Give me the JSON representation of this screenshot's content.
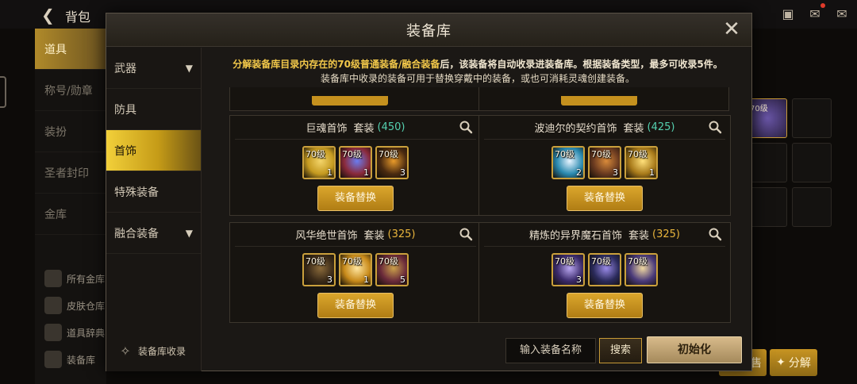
{
  "background": {
    "back_arrow": "back-arrow-icon",
    "title": "背包",
    "tabs": [
      "道具",
      "称号/勋章",
      "装扮",
      "圣者封印",
      "金库"
    ],
    "tools": [
      "所有金库",
      "皮肤仓库",
      "道具辞典",
      "装备库"
    ],
    "grid_item_level": "70级",
    "decompose": "分解",
    "sell": "售"
  },
  "modal": {
    "title": "装备库",
    "close_icon": "close-icon",
    "categories": [
      {
        "label": "武器",
        "expandable": true
      },
      {
        "label": "防具",
        "expandable": false
      },
      {
        "label": "首饰",
        "expandable": false,
        "active": true
      },
      {
        "label": "特殊装备",
        "expandable": false
      },
      {
        "label": "融合装备",
        "expandable": true
      }
    ],
    "collect_label": "装备库收录",
    "notice_line1_a": "分解装备库目录内存在的70级普通装备/融合装备",
    "notice_line1_b": "后，该装备将自动收录进装备库。根据装备类型，最多可收录5件。",
    "notice_line2": "装备库中收录的装备可用于替换穿戴中的装备，或也可消耗灵魂创建装备。",
    "sets": [
      {
        "name": "巨魂首饰",
        "kind": "套装",
        "count": "(450)",
        "count_color": "#55d1b0",
        "button": "装备替换",
        "items": [
          {
            "level": "70级",
            "qty": "1",
            "bg": "#c59a20",
            "gem": "#f3d46a"
          },
          {
            "level": "70级",
            "qty": "1",
            "bg": "#8a2a3a",
            "gem": "#6a7cf0"
          },
          {
            "level": "70级",
            "qty": "3",
            "bg": "#4a2a10",
            "gem": "#e89a2a"
          }
        ]
      },
      {
        "name": "波迪尔的契约首饰",
        "kind": "套装",
        "count": "(425)",
        "count_color": "#55d1b0",
        "button": "装备替换",
        "items": [
          {
            "level": "70级",
            "qty": "2",
            "bg": "#2a8ab0",
            "gem": "#e8f4ff"
          },
          {
            "level": "70级",
            "qty": "3",
            "bg": "#6a3a20",
            "gem": "#d88a3a"
          },
          {
            "level": "70级",
            "qty": "1",
            "bg": "#a87a1a",
            "gem": "#ffe07a"
          }
        ]
      },
      {
        "name": "风华绝世首饰",
        "kind": "套装",
        "count": "(325)",
        "count_color": "#e9b53c",
        "button": "装备替换",
        "items": [
          {
            "level": "70级",
            "qty": "3",
            "bg": "#3a2a18",
            "gem": "#8a6a3a"
          },
          {
            "level": "70级",
            "qty": "1",
            "bg": "#c88a1a",
            "gem": "#ffe6a0"
          },
          {
            "level": "70级",
            "qty": "5",
            "bg": "#6a2a3a",
            "gem": "#caa04a"
          }
        ]
      },
      {
        "name": "精炼的异界魔石首饰",
        "kind": "套装",
        "count": "(325)",
        "count_color": "#e9b53c",
        "button": "装备替换",
        "items": [
          {
            "level": "70级",
            "qty": "3",
            "bg": "#3a2a6a",
            "gem": "#b9a6f0"
          },
          {
            "level": "70级",
            "qty": "",
            "bg": "#2a2a5a",
            "gem": "#9a8ae8"
          },
          {
            "level": "70级",
            "qty": "",
            "bg": "#4a3a7a",
            "gem": "#f0d8a0"
          }
        ]
      }
    ],
    "search_placeholder": "输入装备名称",
    "search_button": "搜索",
    "reset_button": "初始化"
  }
}
